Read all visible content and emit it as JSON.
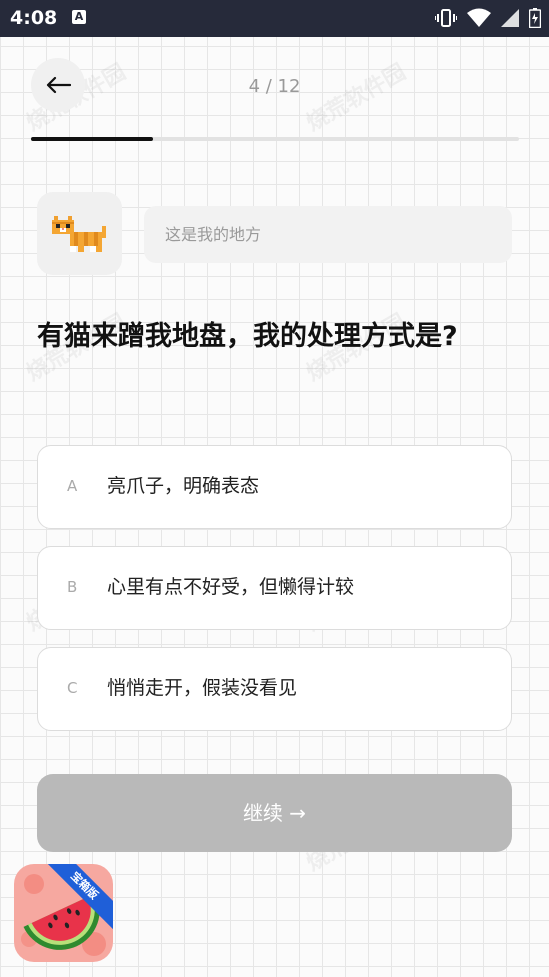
{
  "status_bar": {
    "time": "4:08",
    "notification_badge": "A"
  },
  "header": {
    "progress_text": "4 / 12",
    "progress_fraction": 0.25
  },
  "speech": {
    "text": "这是我的地方"
  },
  "question": {
    "text": "有猫来蹭我地盘，我的处理方式是?"
  },
  "options": [
    {
      "letter": "A",
      "text": "亮爪子，明确表态"
    },
    {
      "letter": "B",
      "text": "心里有点不好受，但懒得计较"
    },
    {
      "letter": "C",
      "text": "悄悄走开，假装没看见"
    }
  ],
  "continue_button": {
    "label": "继续 →"
  },
  "app_badge": {
    "ribbon": "宝箱版"
  },
  "watermark": "烧荒软件园",
  "colors": {
    "status_bar": "#262a3a",
    "progress": "#111111",
    "disabled_button": "#b9b9b9"
  },
  "icons": [
    "back-arrow-icon",
    "cat-pixel-icon",
    "vibrate-icon",
    "wifi-icon",
    "signal-icon",
    "battery-icon",
    "watermelon-app-icon"
  ]
}
